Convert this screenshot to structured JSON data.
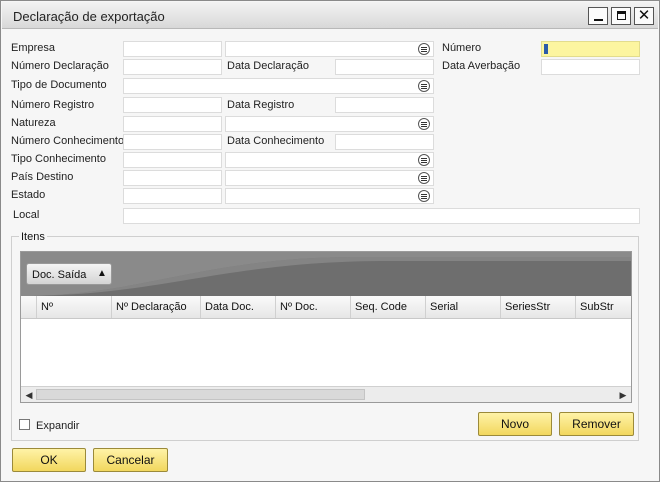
{
  "window": {
    "title": "Declaração de exportação",
    "minimize_glyph": "",
    "maximize_glyph": "",
    "close_glyph": "✕"
  },
  "form": {
    "labels": {
      "empresa": "Empresa",
      "numero_declaracao": "Número Declaração",
      "data_declaracao": "Data Declaração",
      "tipo_documento": "Tipo de Documento",
      "numero_registro": "Número Registro",
      "data_registro": "Data Registro",
      "natureza": "Natureza",
      "numero_conhecimento": "Número Conhecimento",
      "data_conhecimento": "Data Conhecimento",
      "tipo_conhecimento": "Tipo Conhecimento",
      "pais_destino": "País Destino",
      "estado": "Estado",
      "local": "Local",
      "numero": "Número",
      "data_averbacao": "Data Averbação"
    },
    "values": {
      "empresa_code": "",
      "empresa_name": "",
      "numero_declaracao": "",
      "data_declaracao": "",
      "tipo_documento": "",
      "numero_registro": "",
      "data_registro": "",
      "natureza_code": "",
      "natureza_name": "",
      "numero_conhecimento": "",
      "data_conhecimento": "",
      "tipo_conhecimento_code": "",
      "tipo_conhecimento_name": "",
      "pais_destino_code": "",
      "pais_destino_name": "",
      "estado_code": "",
      "estado_name": "",
      "local": "",
      "numero": "",
      "data_averbacao": ""
    }
  },
  "items": {
    "title": "Itens",
    "group_by": "Doc. Saída",
    "columns": [
      "Nº",
      "Nº Declaração",
      "Data Doc.",
      "Nº Doc.",
      "Seq. Code",
      "Serial",
      "SeriesStr",
      "SubStr"
    ],
    "rows": []
  },
  "expandir_label": "Expandir",
  "buttons": {
    "novo": "Novo",
    "remover": "Remover",
    "ok": "OK",
    "cancelar": "Cancelar"
  },
  "colors": {
    "accent_button": "#f2d75e",
    "active_field": "#fcf5a0",
    "grid_header_band": "#777777"
  }
}
